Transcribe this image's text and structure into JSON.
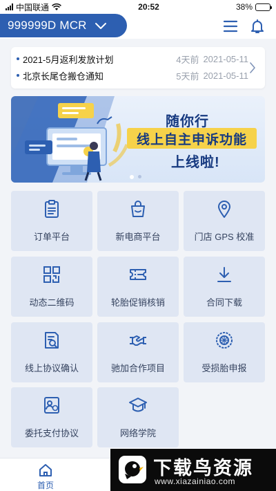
{
  "status_bar": {
    "carrier": "中国联通",
    "time": "20:52",
    "battery_percent": "38%",
    "battery_level": 0.38
  },
  "header": {
    "account_label": "999999D MCR",
    "icons": [
      "chevron-down-icon",
      "menu-icon",
      "bell-icon"
    ]
  },
  "notices": [
    {
      "title": "2021-5月返利发放计划",
      "ago": "4天前",
      "date": "2021-05-11"
    },
    {
      "title": "北京长尾仓搬仓通知",
      "ago": "5天前",
      "date": "2021-05-11"
    }
  ],
  "banner": {
    "line1": "随你行",
    "line2": "线上自主申诉功能",
    "line3": "上线啦!",
    "slides": 2,
    "active_slide": 1
  },
  "grid": [
    {
      "label": "订单平台",
      "icon": "clipboard-icon"
    },
    {
      "label": "新电商平台",
      "icon": "shopping-bag-icon"
    },
    {
      "label": "门店 GPS 校准",
      "icon": "location-pin-icon"
    },
    {
      "label": "动态二维码",
      "icon": "qr-code-icon"
    },
    {
      "label": "轮胎促销核销",
      "icon": "ticket-icon"
    },
    {
      "label": "合同下载",
      "icon": "download-icon"
    },
    {
      "label": "线上协议确认",
      "icon": "document-search-icon"
    },
    {
      "label": "驰加合作项目",
      "icon": "handshake-icon"
    },
    {
      "label": "受损胎申报",
      "icon": "tire-icon"
    },
    {
      "label": "委托支付协议",
      "icon": "payment-card-icon"
    },
    {
      "label": "网络学院",
      "icon": "graduation-cap-icon"
    }
  ],
  "tabbar": {
    "home_label": "首页"
  },
  "watermark": {
    "title": "下载鸟资源",
    "url": "www.xiazainiao.com"
  },
  "colors": {
    "brand": "#2d5fb1",
    "tile_bg": "#dfe6f3",
    "banner_highlight": "#f6d24a"
  }
}
